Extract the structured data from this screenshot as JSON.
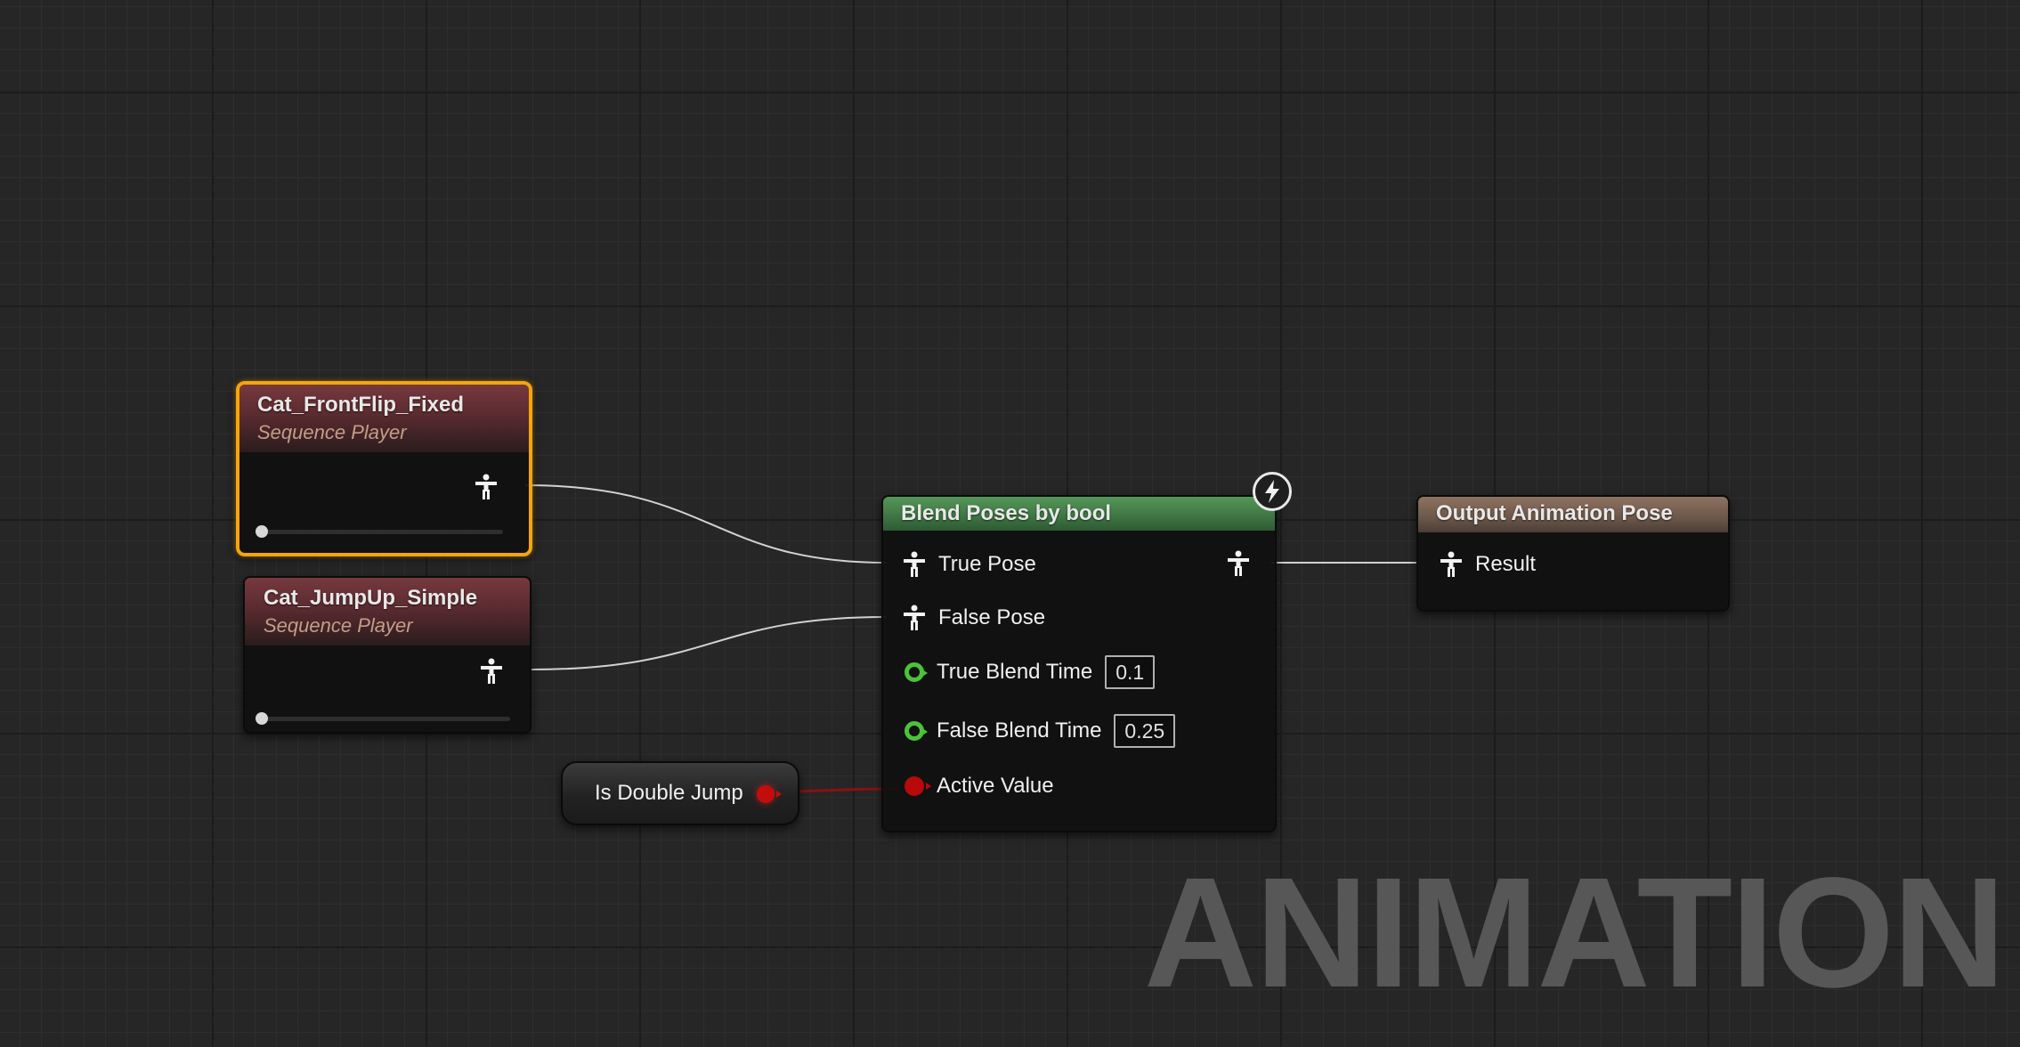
{
  "graph": {
    "watermark": "ANIMATION",
    "nodes": {
      "front_flip": {
        "title": "Cat_FrontFlip_Fixed",
        "subtitle": "Sequence Player",
        "selected": true,
        "play_position": 0.0
      },
      "jump_up": {
        "title": "Cat_JumpUp_Simple",
        "subtitle": "Sequence Player",
        "play_position": 0.0
      },
      "blend": {
        "title": "Blend Poses by bool",
        "fast_path_icon": "lightning-bolt-icon",
        "pins": {
          "true_pose": "True Pose",
          "false_pose": "False Pose",
          "true_blend_time": "True Blend Time",
          "true_blend_time_value": "0.1",
          "false_blend_time": "False Blend Time",
          "false_blend_time_value": "0.25",
          "active_value": "Active Value"
        }
      },
      "output": {
        "title": "Output Animation Pose",
        "pins": {
          "result": "Result"
        }
      },
      "variable": {
        "label": "Is Double Jump"
      }
    },
    "colors": {
      "selection": "#f5a50a",
      "sequence_header": "#76393d",
      "blend_header": "#549758",
      "output_header": "#8e7260",
      "float_pin": "#4cc23a",
      "bool_pin": "#c40c0c",
      "pose_wire": "#d6d6d6",
      "bool_wire": "#8a1010"
    }
  }
}
